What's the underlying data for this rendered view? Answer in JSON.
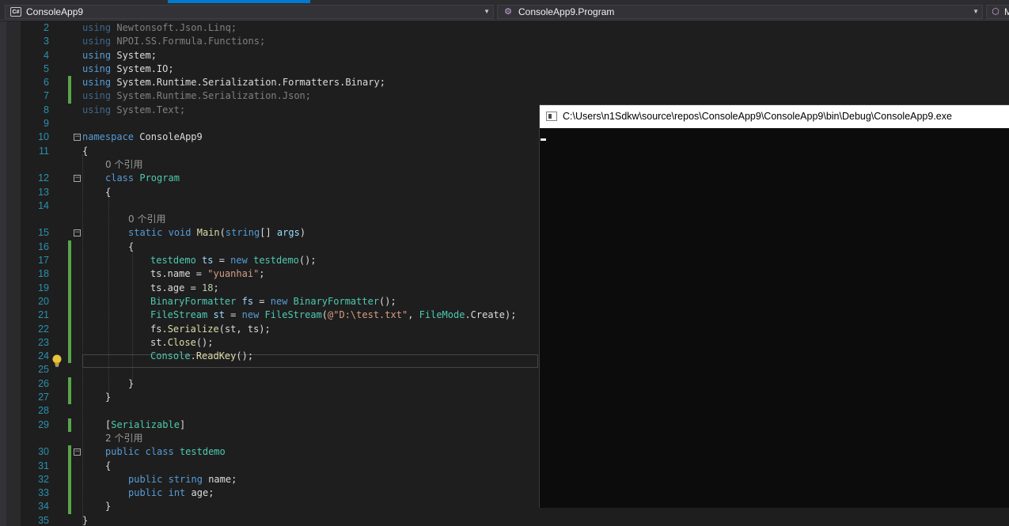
{
  "navbar": {
    "project": {
      "icon_text": "C#",
      "label": "ConsoleApp9"
    },
    "class": {
      "icon": "class-icon",
      "label": "ConsoleApp9.Program"
    },
    "member": {
      "icon": "method-icon",
      "label": "M"
    }
  },
  "code_lens": {
    "program_refs": "0 个引用",
    "main_refs": "0 个引用",
    "testdemo_refs": "2 个引用"
  },
  "editor": {
    "line_numbers": [
      "2",
      "3",
      "4",
      "5",
      "6",
      "7",
      "8",
      "9",
      "10",
      "11",
      "12",
      "13",
      "14",
      "15",
      "16",
      "17",
      "18",
      "19",
      "20",
      "21",
      "22",
      "23",
      "24",
      "25",
      "26",
      "27",
      "28",
      "29",
      "30",
      "31",
      "32",
      "33",
      "34",
      "35"
    ],
    "tokens": {
      "using": "using",
      "u2": "Newtonsoft.Json.Linq;",
      "u3": "NPOI.SS.Formula.Functions;",
      "u4": "System;",
      "u5": "System.IO;",
      "u6": "System.Runtime.Serialization.Formatters.Binary;",
      "u7": "System.Runtime.Serialization.Json;",
      "u8": "System.Text;",
      "namespace": "namespace",
      "ns_name": "ConsoleApp9",
      "open_brace": "{",
      "close_brace": "}",
      "class": "class",
      "program": "Program",
      "static": "static",
      "void": "void",
      "main": "Main",
      "lparen": "(",
      "string": "string",
      "main_args": "[] ",
      "args": "args",
      "rparen": ")",
      "testdemo": "testdemo",
      "ts": "ts",
      "eq": " = ",
      "new": "new",
      "ctor_end": "();",
      "ts_name": "ts.name",
      "yuanhai": "\"yuanhai\"",
      "semi": ";",
      "ts_age": "ts.age",
      "eighteen": "18",
      "binaryformatter": "BinaryFormatter",
      "fs": "fs",
      "filestream": "FileStream",
      "st": "st",
      "verbatim": "@\"D:\\test.txt\"",
      "comma": ", ",
      "filemode": "FileMode",
      "create": ".Create",
      "close_paren_semi": ");",
      "fs_dot": "fs.",
      "serialize": "Serialize",
      "serialize_args": "(st, ts);",
      "st_dot": "st.",
      "close": "Close",
      "call_end": "();",
      "console": "Console",
      "dot": ".",
      "readkey": "ReadKey",
      "attr_open": "[",
      "serializable": "Serializable",
      "attr_close": "]",
      "public": "public",
      "name_field": "name;",
      "int": "int",
      "age_field": "age;"
    }
  },
  "console": {
    "title": "C:\\Users\\n1Sdkw\\source\\repos\\ConsoleApp9\\ConsoleApp9\\bin\\Debug\\ConsoleApp9.exe"
  }
}
